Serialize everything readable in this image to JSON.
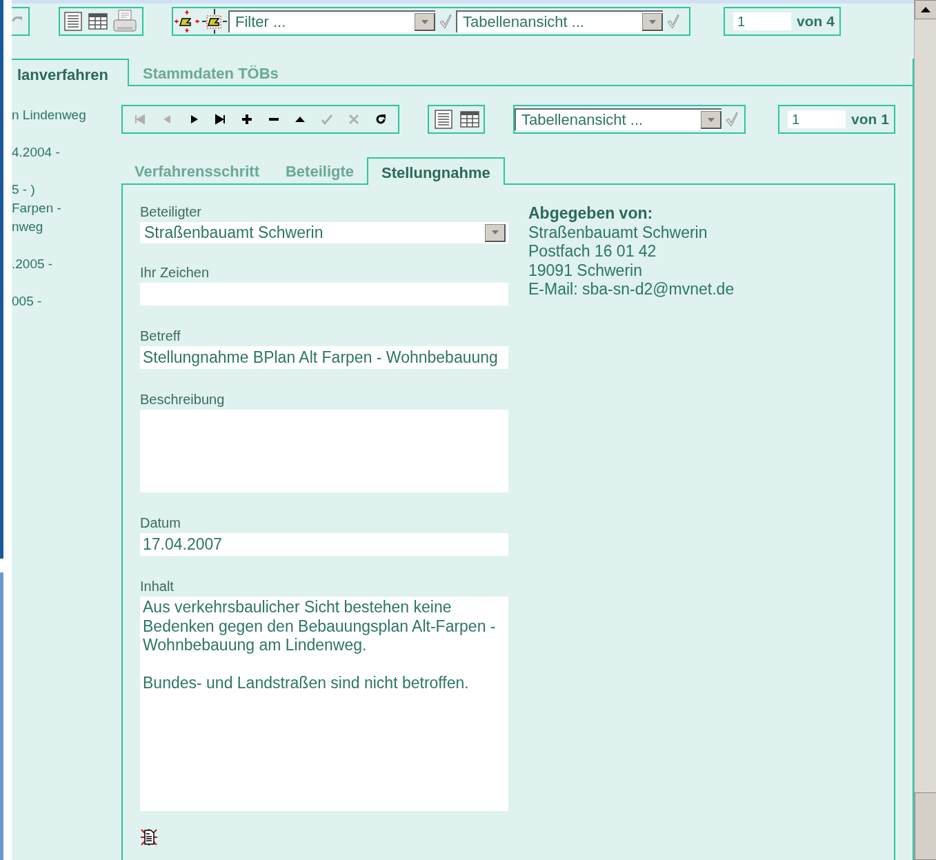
{
  "toolbar": {
    "filter_select": {
      "value": "Filter ..."
    },
    "view_select": {
      "value": "Tabellenansicht ..."
    },
    "pager": {
      "page": "1",
      "total": "von 4"
    }
  },
  "outer_tabs": [
    {
      "label": "lanverfahren",
      "selected": true
    },
    {
      "label": "Stammdaten TÖBs",
      "selected": false
    }
  ],
  "sidebar": {
    "entries": [
      {
        "lines": [
          "n Lindenweg"
        ]
      },
      {
        "lines": [
          "4.2004 -"
        ]
      },
      {
        "lines": [
          "5 - )",
          "Farpen -",
          "nweg"
        ]
      },
      {
        "lines": [
          ".2005 -"
        ]
      },
      {
        "lines": [
          "005 -"
        ]
      }
    ]
  },
  "record_toolbar": {
    "nav_buttons": [
      {
        "kind": "first",
        "disabled": true
      },
      {
        "kind": "prev",
        "disabled": true
      },
      {
        "kind": "next",
        "disabled": false
      },
      {
        "kind": "last",
        "disabled": false
      },
      {
        "kind": "add",
        "disabled": false
      },
      {
        "kind": "remove",
        "disabled": false
      },
      {
        "kind": "up",
        "disabled": false
      },
      {
        "kind": "confirm",
        "disabled": true
      },
      {
        "kind": "cancel",
        "disabled": true
      },
      {
        "kind": "reload",
        "disabled": false
      }
    ],
    "view_select": {
      "value": "Tabellenansicht ..."
    },
    "pager": {
      "page": "1",
      "total": "von 1"
    }
  },
  "inner_tabs": [
    {
      "label": "Verfahrensschritt",
      "selected": false
    },
    {
      "label": "Beteiligte",
      "selected": false
    },
    {
      "label": "Stellungnahme",
      "selected": true
    }
  ],
  "form": {
    "fields": [
      {
        "kind": "select",
        "label": "Beteiligter",
        "value": "Straßenbauamt Schwerin"
      },
      {
        "kind": "text",
        "label": "Ihr Zeichen"
      },
      {
        "kind": "text",
        "label": "Betreff",
        "value": "Stellungnahme BPlan Alt Farpen - Wohnbebauung"
      },
      {
        "kind": "textarea",
        "label": "Beschreibung"
      },
      {
        "kind": "text",
        "label": "Datum",
        "value": "17.04.2007"
      },
      {
        "kind": "memo",
        "label": "Inhalt",
        "value": "Aus verkehrsbaulicher Sicht bestehen keine Bedenken gegen den Bebauungsplan Alt-Farpen - Wohnbebauung am Lindenweg.\n\nBundes- und Landstraßen sind nicht betroffen."
      }
    ]
  },
  "sender": {
    "heading": "Abgegeben von:",
    "lines": [
      "Straßenbauamt Schwerin",
      "Postfach 16 01 42",
      "19091 Schwerin",
      "E-Mail: sba-sn-d2@mvnet.de"
    ]
  }
}
